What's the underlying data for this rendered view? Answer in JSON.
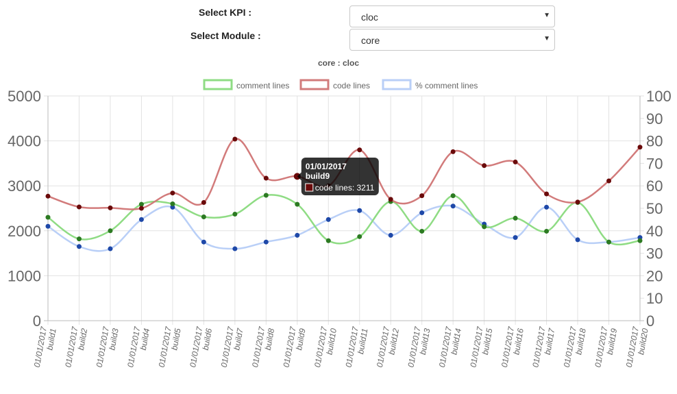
{
  "controls": {
    "kpi_label": "Select KPI :",
    "kpi_value": "cloc",
    "module_label": "Select Module :",
    "module_value": "core",
    "dropdown_arrow_icon": "caret-down-icon"
  },
  "chart_title": "core : cloc",
  "chart_data": {
    "type": "line",
    "categories": [
      [
        "01/01/2017",
        "build1"
      ],
      [
        "01/01/2017",
        "build2"
      ],
      [
        "01/01/2017",
        "build3"
      ],
      [
        "01/01/2017",
        "build4"
      ],
      [
        "01/01/2017",
        "build5"
      ],
      [
        "01/01/2017",
        "build6"
      ],
      [
        "01/01/2017",
        "build7"
      ],
      [
        "01/01/2017",
        "build8"
      ],
      [
        "01/01/2017",
        "build9"
      ],
      [
        "01/01/2017",
        "build10"
      ],
      [
        "01/01/2017",
        "build11"
      ],
      [
        "01/01/2017",
        "build12"
      ],
      [
        "01/01/2017",
        "build13"
      ],
      [
        "01/01/2017",
        "build14"
      ],
      [
        "01/01/2017",
        "build15"
      ],
      [
        "01/01/2017",
        "build16"
      ],
      [
        "01/01/2017",
        "build17"
      ],
      [
        "01/01/2017",
        "build18"
      ],
      [
        "01/01/2017",
        "build19"
      ],
      [
        "01/01/2017",
        "build20"
      ]
    ],
    "y_left": {
      "min": 0,
      "max": 5000,
      "ticks": [
        0,
        1000,
        2000,
        3000,
        4000,
        5000
      ]
    },
    "y_right": {
      "min": 0,
      "max": 100,
      "ticks": [
        0,
        10,
        20,
        30,
        40,
        50,
        60,
        70,
        80,
        90,
        100
      ]
    },
    "grid": true,
    "legend_position": "top",
    "series": [
      {
        "name": "comment lines",
        "axis": "left",
        "color": "#8fdc84",
        "point_color": "#2c7a22",
        "values": [
          2300,
          1820,
          2000,
          2590,
          2600,
          2310,
          2370,
          2790,
          2590,
          1780,
          1870,
          2650,
          1990,
          2780,
          2090,
          2280,
          1990,
          2630,
          1750,
          1780
        ]
      },
      {
        "name": "code lines",
        "axis": "left",
        "color": "#d27b7b",
        "point_color": "#6a0a0a",
        "values": [
          2770,
          2530,
          2510,
          2500,
          2840,
          2630,
          4040,
          3170,
          3211,
          3000,
          3800,
          2700,
          2780,
          3760,
          3450,
          3530,
          2820,
          2640,
          3110,
          3860
        ]
      },
      {
        "name": "% comment lines",
        "axis": "right",
        "color": "#b9cff7",
        "point_color": "#1e48a8",
        "values": [
          42,
          33,
          32,
          45,
          50.5,
          35,
          32,
          35,
          38,
          45,
          49,
          38,
          48,
          51,
          43,
          37,
          50.5,
          36,
          35,
          37
        ]
      }
    ],
    "tooltip": {
      "title": "01/01/2017",
      "subtitle": "build9",
      "text": "code lines: 3211",
      "index": 8,
      "series": 1
    }
  }
}
